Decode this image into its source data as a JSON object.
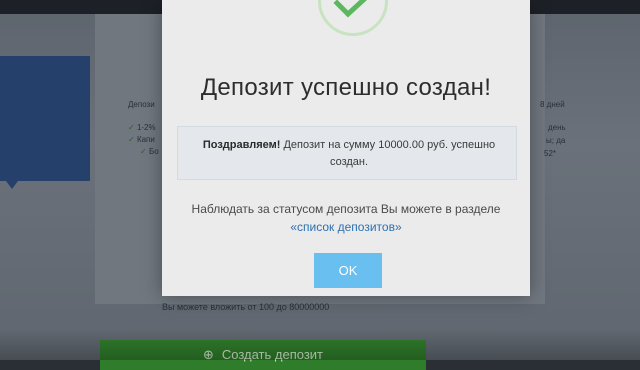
{
  "modal": {
    "title": "Депозит успешно создан!",
    "notice_strong": "Поздравляем!",
    "notice_text": " Депозит на сумму 10000.00 руб. успешно создан.",
    "info_text": "Наблюдать за статусом депозита Вы можете в разделе",
    "info_link": "«список депозитов»",
    "ok_label": "OK",
    "success_icon": "checkmark-icon",
    "accent_color": "#69bff0",
    "success_color": "#5cb85c"
  },
  "background": {
    "deposit_label": "Депози",
    "days_label": "8 дней",
    "rate_label": "1-2%",
    "capital_label": "Капи",
    "bonus_label": "Бо",
    "right_line1": "день",
    "right_line2": "ы; да",
    "right_line3": "52*",
    "range_hint": "Вы можете вложить от 100 до 80000000",
    "create_button_label": "Создать депозит",
    "create_button_color": "#2f7d2b"
  }
}
